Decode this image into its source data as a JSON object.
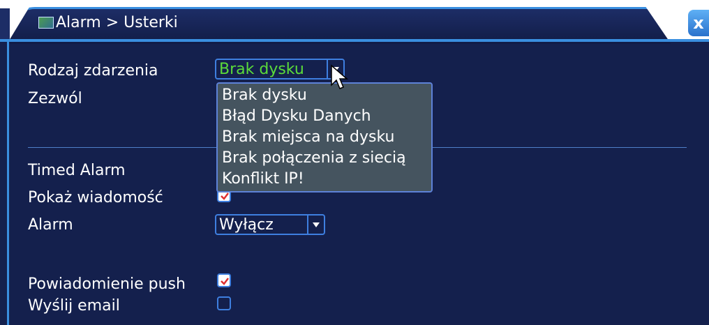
{
  "window": {
    "title": "Alarm > Usterki",
    "title_icon": "alarm-window-icon",
    "close_label": "x"
  },
  "form": {
    "event_type_label": "Rodzaj zdarzenia",
    "event_type_value": "Brak dysku",
    "enable_label": "Zezwól",
    "timed_alarm_label": "Timed Alarm",
    "show_message_label": "Pokaż wiadomość",
    "show_message_checked": true,
    "alarm_label": "Alarm",
    "alarm_value": "Wyłącz",
    "push_label": "Powiadomienie push",
    "push_checked": true,
    "email_label": "Wyślij email",
    "email_checked": false
  },
  "dropdown": {
    "options": [
      "Brak dysku",
      "Błąd Dysku Danych",
      "Brak miejsca na dysku",
      "Brak połączenia z siecią",
      "Konflikt IP!"
    ]
  },
  "colors": {
    "background": "#14204d",
    "accent": "#3a8fe0",
    "selected_value": "#5bdb3a",
    "dropdown_bg": "#45545f",
    "check_mark": "#e03030"
  }
}
